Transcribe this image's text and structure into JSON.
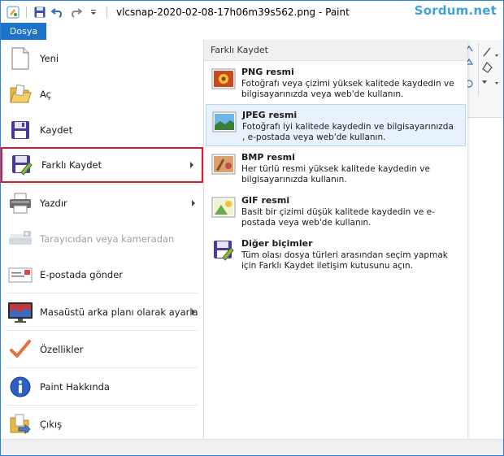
{
  "window": {
    "title": "vlcsnap-2020-02-08-17h06m39s562.png - Paint",
    "watermark": "Sordum.net",
    "file_tab": "Dosya"
  },
  "menu": {
    "items": [
      {
        "label": "Yeni",
        "icon": "new-document-icon"
      },
      {
        "label": "Aç",
        "icon": "open-folder-icon"
      },
      {
        "label": "Kaydet",
        "icon": "save-icon"
      },
      {
        "label": "Farklı Kaydet",
        "icon": "save-as-icon"
      },
      {
        "label": "Yazdır",
        "icon": "printer-icon"
      },
      {
        "label": "Tarayıcıdan veya kameradan",
        "icon": "scanner-icon"
      },
      {
        "label": "E-postada gönder",
        "icon": "email-icon"
      },
      {
        "label": "Masaüstü arka planı olarak ayarla",
        "icon": "desktop-background-icon"
      },
      {
        "label": "Özellikler",
        "icon": "checkmark-icon"
      },
      {
        "label": "Paint Hakkında",
        "icon": "info-icon"
      },
      {
        "label": "Çıkış",
        "icon": "exit-icon"
      }
    ]
  },
  "submenu": {
    "header": "Farklı Kaydet",
    "items": [
      {
        "title": "PNG resmi",
        "desc1": "Fotoğrafı veya çizimi yüksek kalitede kaydedin ve",
        "desc2": "bilgisayarınızda veya web'de kullanın.",
        "icon": "png-image-icon"
      },
      {
        "title": "JPEG resmi",
        "desc1": "Fotoğrafı iyi kalitede kaydedin ve bilgisayarınızda",
        "desc2": ", e-postada veya web'de kullanın.",
        "icon": "jpeg-image-icon"
      },
      {
        "title": "BMP resmi",
        "desc1": "Her türlü resmi yüksek kalitede kaydedin ve",
        "desc2": "bilgisayarınızda kullanın.",
        "icon": "bmp-image-icon"
      },
      {
        "title": "GIF resmi",
        "desc1": "Basit bir çizimi düşük kalitede kaydedin ve e-",
        "desc2": "postada veya web'de kullanın.",
        "icon": "gif-image-icon"
      },
      {
        "title": "Diğer biçimler",
        "desc1": "Tüm olası dosya türleri arasından seçim yapmak",
        "desc2": "için Farklı Kaydet iletişim kutusunu açın.",
        "icon": "other-formats-icon"
      }
    ]
  },
  "colors": {
    "accent": "#1c73c9",
    "highlight_border": "#e0182e",
    "hover_bg": "#e8f2fc",
    "watermark": "#3fa2d9"
  }
}
